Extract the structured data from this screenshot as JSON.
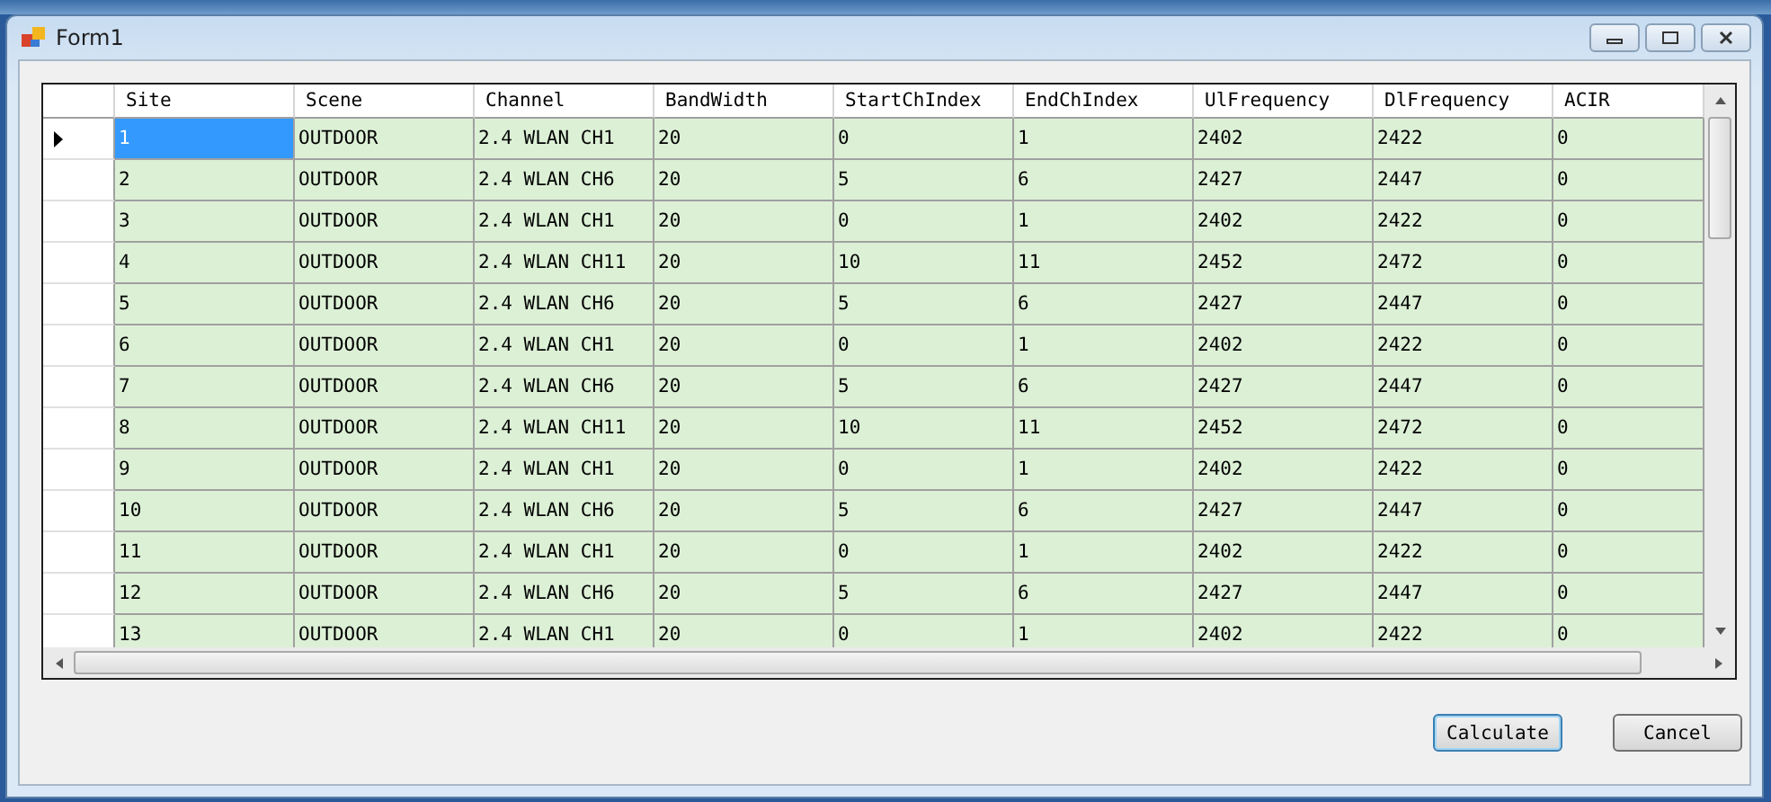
{
  "window": {
    "title": "Form1"
  },
  "table": {
    "columns": [
      "Site",
      "Scene",
      "Channel",
      "BandWidth",
      "StartChIndex",
      "EndChIndex",
      "UlFrequency",
      "DlFrequency",
      "ACIR"
    ],
    "rows": [
      {
        "selected": true,
        "cells": [
          "1",
          "OUTDOOR",
          "2.4 WLAN CH1",
          "20",
          "0",
          "1",
          "2402",
          "2422",
          "0"
        ]
      },
      {
        "selected": false,
        "cells": [
          "2",
          "OUTDOOR",
          "2.4 WLAN CH6",
          "20",
          "5",
          "6",
          "2427",
          "2447",
          "0"
        ]
      },
      {
        "selected": false,
        "cells": [
          "3",
          "OUTDOOR",
          "2.4 WLAN CH1",
          "20",
          "0",
          "1",
          "2402",
          "2422",
          "0"
        ]
      },
      {
        "selected": false,
        "cells": [
          "4",
          "OUTDOOR",
          "2.4 WLAN CH11",
          "20",
          "10",
          "11",
          "2452",
          "2472",
          "0"
        ]
      },
      {
        "selected": false,
        "cells": [
          "5",
          "OUTDOOR",
          "2.4 WLAN CH6",
          "20",
          "5",
          "6",
          "2427",
          "2447",
          "0"
        ]
      },
      {
        "selected": false,
        "cells": [
          "6",
          "OUTDOOR",
          "2.4 WLAN CH1",
          "20",
          "0",
          "1",
          "2402",
          "2422",
          "0"
        ]
      },
      {
        "selected": false,
        "cells": [
          "7",
          "OUTDOOR",
          "2.4 WLAN CH6",
          "20",
          "5",
          "6",
          "2427",
          "2447",
          "0"
        ]
      },
      {
        "selected": false,
        "cells": [
          "8",
          "OUTDOOR",
          "2.4 WLAN CH11",
          "20",
          "10",
          "11",
          "2452",
          "2472",
          "0"
        ]
      },
      {
        "selected": false,
        "cells": [
          "9",
          "OUTDOOR",
          "2.4 WLAN CH1",
          "20",
          "0",
          "1",
          "2402",
          "2422",
          "0"
        ]
      },
      {
        "selected": false,
        "cells": [
          "10",
          "OUTDOOR",
          "2.4 WLAN CH6",
          "20",
          "5",
          "6",
          "2427",
          "2447",
          "0"
        ]
      },
      {
        "selected": false,
        "cells": [
          "11",
          "OUTDOOR",
          "2.4 WLAN CH1",
          "20",
          "0",
          "1",
          "2402",
          "2422",
          "0"
        ]
      },
      {
        "selected": false,
        "cells": [
          "12",
          "OUTDOOR",
          "2.4 WLAN CH6",
          "20",
          "5",
          "6",
          "2427",
          "2447",
          "0"
        ]
      },
      {
        "selected": false,
        "cells": [
          "13",
          "OUTDOOR",
          "2.4 WLAN CH1",
          "20",
          "0",
          "1",
          "2402",
          "2422",
          "0"
        ]
      }
    ]
  },
  "buttons": [
    {
      "label": "Calculate",
      "default": true
    },
    {
      "label": "Cancel",
      "default": false
    }
  ]
}
